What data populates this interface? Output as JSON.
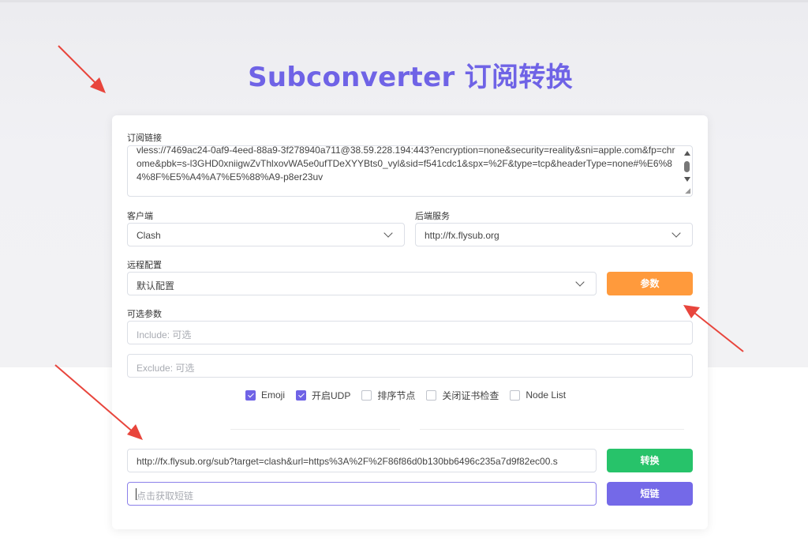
{
  "page": {
    "title": "Subconverter 订阅转换",
    "accent_color": "#6f63e6"
  },
  "subscription": {
    "label": "订阅链接",
    "value": "vless://7469ac24-0af9-4eed-88a9-3f278940a711@38.59.228.194:443?encryption=none&security=reality&sni=apple.com&fp=chrome&pbk=s-l3GHD0xniigwZvThlxovWA5e0ufTDeXYYBts0_vyl&sid=f541cdc1&spx=%2F&type=tcp&headerType=none#%E6%84%8F%E5%A4%A7%E5%88%A9-p8er23uv"
  },
  "client": {
    "label": "客户端",
    "selected": "Clash"
  },
  "backend": {
    "label": "后端服务",
    "selected": "http://fx.flysub.org"
  },
  "remote_config": {
    "label": "远程配置",
    "selected": "默认配置",
    "params_button": "参数",
    "params_color": "#ff9a3c"
  },
  "optional": {
    "label": "可选参数",
    "include_placeholder": "Include: 可选",
    "exclude_placeholder": "Exclude: 可选"
  },
  "options": [
    {
      "label": "Emoji",
      "checked": true
    },
    {
      "label": "开启UDP",
      "checked": true
    },
    {
      "label": "排序节点",
      "checked": false
    },
    {
      "label": "关闭证书检查",
      "checked": false
    },
    {
      "label": "Node List",
      "checked": false
    }
  ],
  "result": {
    "url": "http://fx.flysub.org/sub?target=clash&url=https%3A%2F%2F86f86d0b130bb6496c235a7d9f82ec00.s",
    "convert_button": "转换",
    "convert_color": "#27c36a",
    "short_placeholder": "点击获取短链",
    "short_button": "短链",
    "short_color": "#7469e8"
  },
  "annotation_color": "#e8453c"
}
